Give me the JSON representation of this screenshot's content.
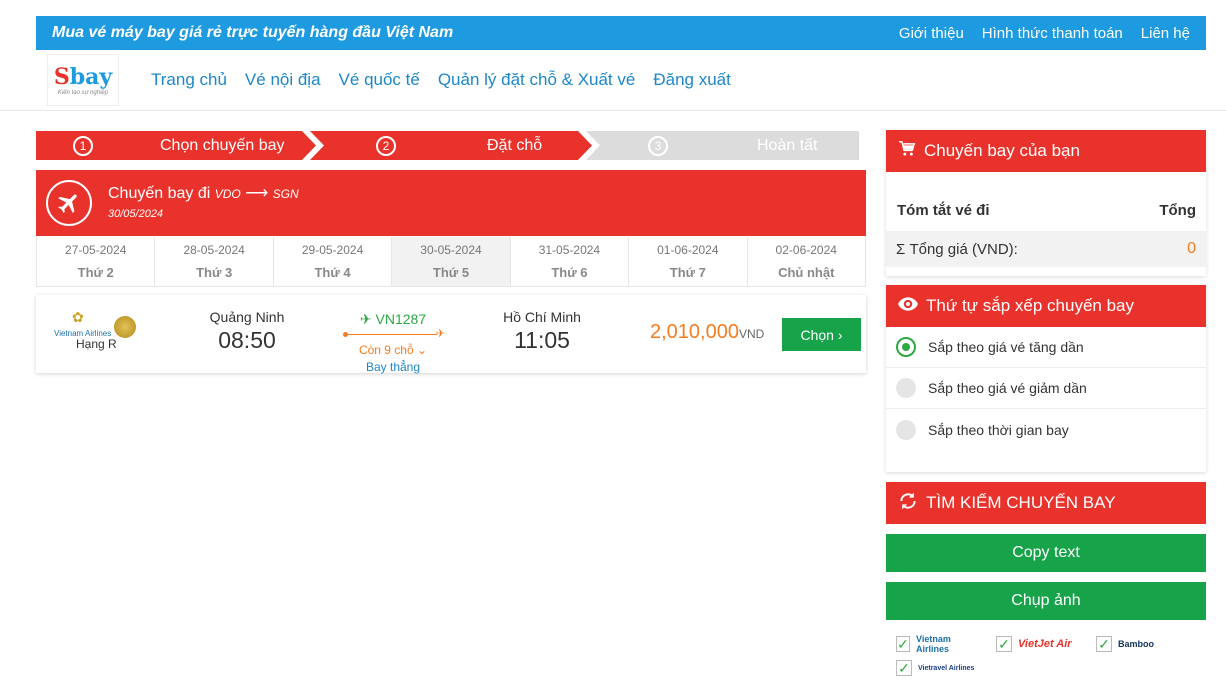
{
  "topbar": {
    "slogan": "Mua vé máy bay giá rẻ trực tuyến hàng đầu Việt Nam",
    "links": [
      "Giới thiệu",
      "Hình thức thanh toán",
      "Liên hệ"
    ]
  },
  "logo": {
    "brand_s": "S",
    "brand_rest": "bay",
    "tagline": "Kiến tạo sự nghiệp"
  },
  "menu": [
    "Trang chủ",
    "Vé nội địa",
    "Vé quốc tế",
    "Quản lý đặt chỗ & Xuất vé",
    "Đăng xuất"
  ],
  "steps": [
    {
      "num": "1",
      "label": "Chọn chuyến bay"
    },
    {
      "num": "2",
      "label": "Đặt chỗ"
    },
    {
      "num": "3",
      "label": "Hoàn tất"
    }
  ],
  "flight_header": {
    "title": "Chuyến bay đi",
    "from": "VDO",
    "to": "SGN",
    "date": "30/05/2024"
  },
  "dates": [
    {
      "date": "27-05-2024",
      "day": "Thứ 2"
    },
    {
      "date": "28-05-2024",
      "day": "Thứ 3"
    },
    {
      "date": "29-05-2024",
      "day": "Thứ 4"
    },
    {
      "date": "30-05-2024",
      "day": "Thứ 5"
    },
    {
      "date": "31-05-2024",
      "day": "Thứ 6"
    },
    {
      "date": "01-06-2024",
      "day": "Thứ 7"
    },
    {
      "date": "02-06-2024",
      "day": "Chủ nhật"
    }
  ],
  "flight": {
    "airline": "Vietnam Airlines",
    "class": "Hạng R",
    "dep_city": "Quảng Ninh",
    "dep_time": "08:50",
    "code": "VN1287",
    "seats": "Còn 9 chỗ",
    "type": "Bay thẳng",
    "arr_city": "Hồ Chí Minh",
    "arr_time": "11:05",
    "price": "2,010,000",
    "currency": "VND",
    "choose_label": "Chọn"
  },
  "summary": {
    "title": "Chuyến bay của bạn",
    "col_left": "Tóm tắt vé đi",
    "col_right": "Tổng",
    "total_label": "Σ Tổng giá (VND):",
    "total_value": "0"
  },
  "sort": {
    "title": "Thứ tự sắp xếp chuyến bay",
    "options": [
      "Sắp theo giá vé tăng dần",
      "Sắp theo giá vé giảm dần",
      "Sắp theo thời gian bay"
    ]
  },
  "search": {
    "title": "TÌM KIẾM CHUYẾN BAY",
    "copy_label": "Copy text",
    "capture_label": "Chụp ảnh",
    "airlines": [
      "Vietnam Airlines",
      "VietJet Air",
      "Bamboo",
      "Vietravel Airlines"
    ]
  },
  "colors": {
    "red": "#e8322b",
    "blue": "#1e9be0",
    "green": "#16a34a",
    "orange": "#f57c1f"
  }
}
